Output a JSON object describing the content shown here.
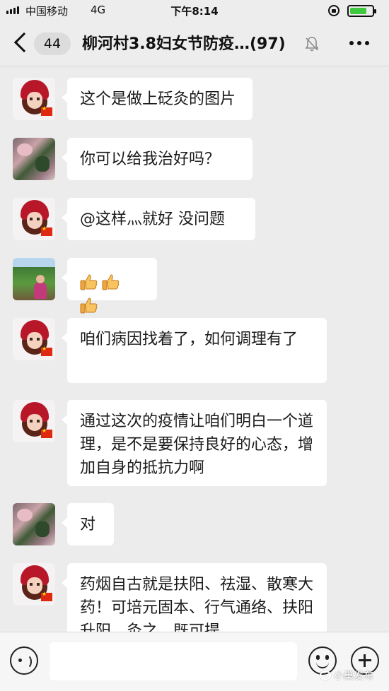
{
  "status_bar": {
    "carrier": "中国移动",
    "network": "4G",
    "time": "下午8:14",
    "battery_level": 0.75
  },
  "header": {
    "back_badge": "44",
    "title": "柳河村3.8妇女节防疫…",
    "member_count": "(97)",
    "icons": [
      "chevron-left-icon",
      "mute-bell-icon",
      "more-dots-icon"
    ]
  },
  "messages": [
    {
      "avatar": "avatar-girl",
      "text": "这个是做上砭灸的图片"
    },
    {
      "avatar": "avatar-flowers",
      "text": "你可以给我治好吗？"
    },
    {
      "avatar": "avatar-girl",
      "text": "@这样灬就好 没问题"
    },
    {
      "avatar": "avatar-field",
      "emoji": [
        "thumbs-up-icon",
        "thumbs-up-icon",
        "thumbs-up-icon"
      ]
    },
    {
      "avatar": "avatar-girl",
      "text": "咱们病因找着了，如何调理有了"
    },
    {
      "avatar": "avatar-girl",
      "text": "通过这次的疫情让咱们明白一个道理，是不是要保持良好的心态，增加自身的抵抗力啊"
    },
    {
      "avatar": "avatar-flowers",
      "text": "对"
    },
    {
      "avatar": "avatar-girl",
      "text": "药烟自古就是扶阳、祛湿、散寒大药！可培元固本、行气通络、扶阳升阳、灸之，既可提"
    }
  ],
  "input_bar": {
    "value": "",
    "icons": [
      "voice-icon",
      "emoji-icon",
      "plus-icon"
    ]
  },
  "watermark": "小巢发布",
  "colors": {
    "background": "#ececec",
    "bubble": "#ffffff",
    "bar": "#ededed",
    "battery": "#3fc93f"
  }
}
